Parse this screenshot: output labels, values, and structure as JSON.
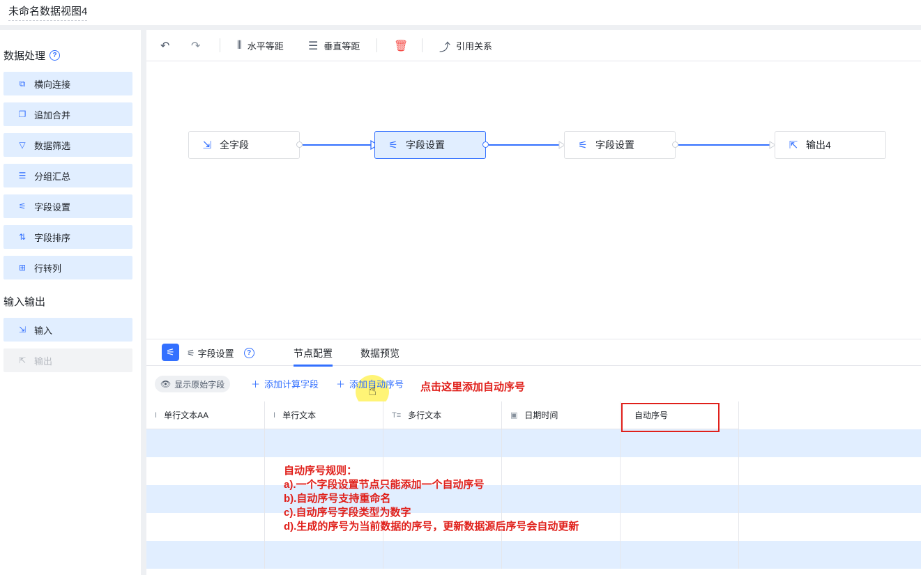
{
  "app": {
    "title": "未命名数据视图4"
  },
  "sidebar": {
    "processing": {
      "title": "数据处理",
      "items": [
        {
          "label": "横向连接",
          "icon": "join-icon"
        },
        {
          "label": "追加合并",
          "icon": "append-icon"
        },
        {
          "label": "数据筛选",
          "icon": "filter-icon"
        },
        {
          "label": "分组汇总",
          "icon": "group-icon"
        },
        {
          "label": "字段设置",
          "icon": "settings-icon"
        },
        {
          "label": "字段排序",
          "icon": "sort-icon"
        },
        {
          "label": "行转列",
          "icon": "pivot-icon"
        }
      ]
    },
    "io": {
      "title": "输入输出",
      "items": [
        {
          "label": "输入",
          "icon": "input-icon",
          "disabled": false
        },
        {
          "label": "输出",
          "icon": "output-icon",
          "disabled": true
        }
      ]
    }
  },
  "toolbar": {
    "horizontal": "水平等距",
    "vertical": "垂直等距",
    "reference": "引用关系"
  },
  "canvas": {
    "nodes": [
      {
        "label": "全字段",
        "icon": "input-icon"
      },
      {
        "label": "字段设置",
        "icon": "settings-icon",
        "active": true
      },
      {
        "label": "字段设置",
        "icon": "settings-icon"
      },
      {
        "label": "输出4",
        "icon": "output-icon"
      }
    ]
  },
  "panel": {
    "name": "字段设置",
    "tabs": [
      {
        "label": "节点配置",
        "active": true
      },
      {
        "label": "数据预览",
        "active": false
      }
    ],
    "show_original": "显示原始字段",
    "add_calc": "添加计算字段",
    "add_auto": "添加自动序号",
    "hint": "点击这里添加自动序号"
  },
  "table": {
    "columns": [
      {
        "label": "单行文本AA",
        "icon": "text-icon"
      },
      {
        "label": "单行文本",
        "icon": "text-icon"
      },
      {
        "label": "多行文本",
        "icon": "multiline-icon"
      },
      {
        "label": "日期时间",
        "icon": "calendar-icon"
      },
      {
        "label": "自动序号",
        "icon": ""
      }
    ]
  },
  "rules": {
    "title": "自动序号规则：",
    "items": [
      "a).一个字段设置节点只能添加一个自动序号",
      "b).自动序号支持重命名",
      "c).自动序号字段类型为数字",
      "d).生成的序号为当前数据的序号，更新数据源后序号会自动更新"
    ]
  },
  "colors": {
    "accent": "#3370ff",
    "annotation": "#e0201b",
    "row_highlight": "#e1eeff"
  }
}
